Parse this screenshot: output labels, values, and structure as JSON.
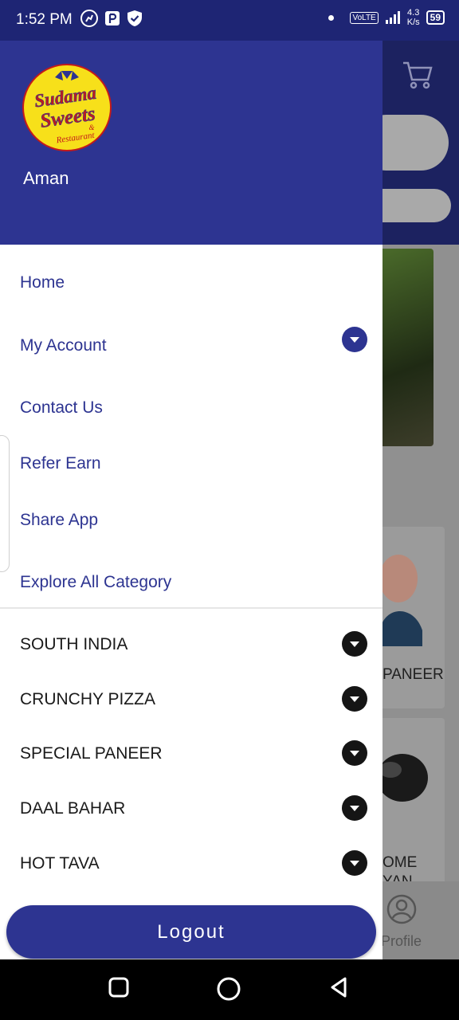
{
  "status_bar": {
    "time": "1:52 PM",
    "net_speed_value": "4.3",
    "net_speed_unit": "K/s",
    "volte": "VoLTE",
    "battery": "59"
  },
  "drawer": {
    "user_name": "Aman",
    "logo": {
      "line1": "Sudama",
      "line2": "Sweets",
      "ampersand": "&",
      "line3": "Restaurant"
    },
    "nav_items": [
      {
        "label": "Home"
      },
      {
        "label": "My Account"
      },
      {
        "label": "Contact Us"
      },
      {
        "label": "Refer Earn"
      },
      {
        "label": "Share App"
      },
      {
        "label": "Explore All Category"
      }
    ],
    "categories": [
      {
        "label": "SOUTH INDIA"
      },
      {
        "label": "CRUNCHY PIZZA"
      },
      {
        "label": "SPECIAL PANEER"
      },
      {
        "label": "DAAL BAHAR"
      },
      {
        "label": "HOT TAVA"
      }
    ],
    "logout_label": "Logout"
  },
  "background": {
    "card1_label": "PANEER",
    "card2_line1": "OME",
    "card2_line2": "YAN",
    "profile_label": "Profile"
  },
  "colors": {
    "primary": "#2d3491",
    "status_bar": "#1e2574",
    "category_arrow": "#151515"
  },
  "icons": [
    "cart-icon",
    "chevron-down-icon",
    "profile-icon",
    "square-icon",
    "circle-icon",
    "back-triangle-icon",
    "wifi-signal-icon",
    "battery-icon"
  ]
}
